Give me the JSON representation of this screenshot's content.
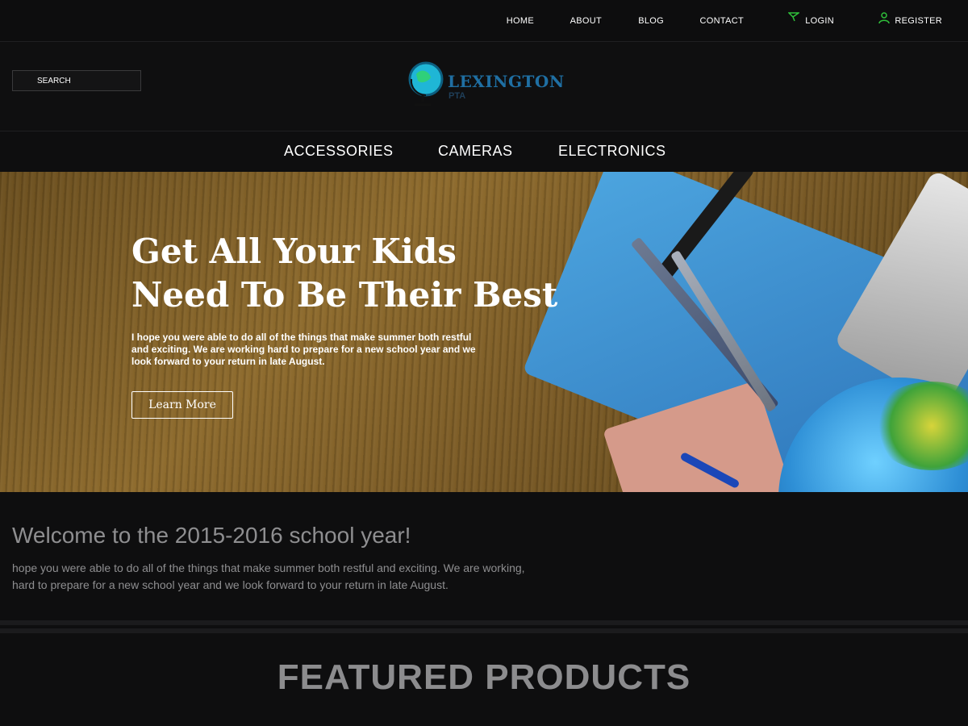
{
  "top_nav": {
    "home": "HOME",
    "about": "ABOUT",
    "blog": "BLOG",
    "contact": "CONTACT",
    "login": "LOGIN",
    "register": "REGISTER",
    "login_icon": "paper-plane-icon",
    "register_icon": "user-icon",
    "accent_color": "#2fbf3a"
  },
  "header": {
    "search_placeholder": "SEARCH",
    "logo_title": "LEXINGTON",
    "logo_sub": "PTA"
  },
  "categories": [
    "ACCESSORIES",
    "CAMERAS",
    "ELECTRONICS"
  ],
  "hero": {
    "title_line1": "Get All Your Kids",
    "title_line2": "Need To Be Their Best",
    "text": "I hope you were able to do all of the things that make summer both restful and exciting.  We are working hard to prepare for a new school year and we look forward to your return in late August.",
    "button": "Learn More"
  },
  "welcome": {
    "title": "Welcome to the 2015-2016 school year!",
    "text": "hope you were able to do all of the things that make summer both restful and exciting. We are working, hard to prepare for a new school year and we look forward to your return in late August."
  },
  "featured_title": "FEATURED PRODUCTS"
}
